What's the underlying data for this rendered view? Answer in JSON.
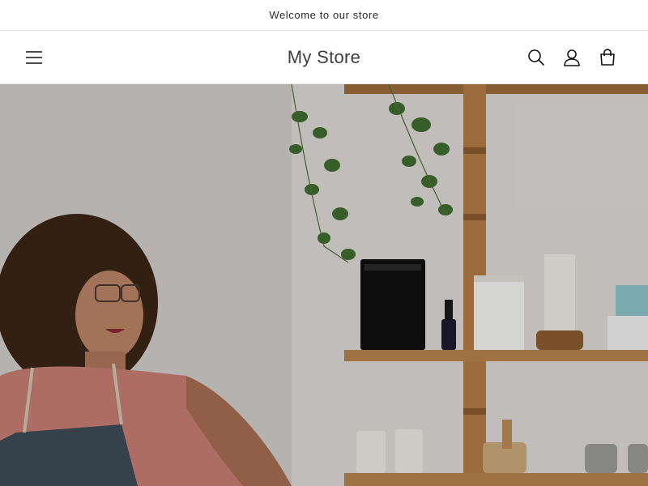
{
  "announcement": {
    "text": "Welcome to our store"
  },
  "header": {
    "store_name": "My Store",
    "icons": {
      "menu": "hamburger-menu-icon",
      "search": "search-icon",
      "account": "account-icon",
      "cart": "cart-icon"
    }
  },
  "hero": {
    "image": "shop-owner-with-shelves-photo"
  },
  "colors": {
    "text": "#121212",
    "border": "#e6e6e6",
    "background": "#ffffff"
  }
}
